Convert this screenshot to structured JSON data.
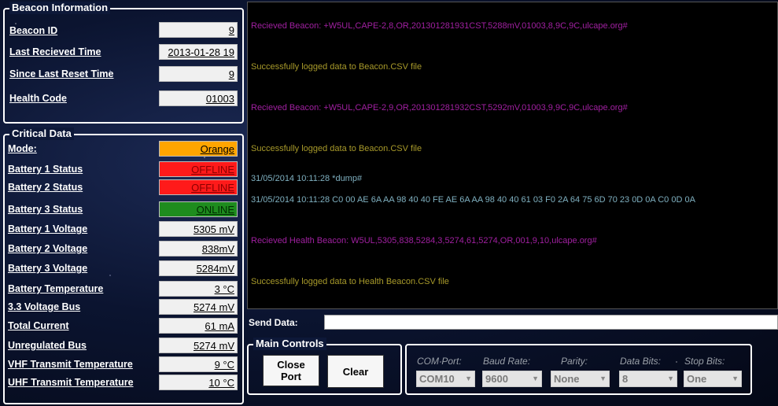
{
  "beacon_info": {
    "title": "Beacon Information",
    "fields": [
      {
        "label": "Beacon ID",
        "value": "9"
      },
      {
        "label": "Last Recieved Time",
        "value": "2013-01-28 19"
      },
      {
        "label": "Since Last Reset Time",
        "value": "9"
      },
      {
        "label": "Health Code",
        "value": "01003"
      }
    ]
  },
  "critical_data": {
    "title": "Critical Data",
    "mode": {
      "label": "Mode:",
      "value": "Orange",
      "color": "#ffa500"
    },
    "battery_status": [
      {
        "label": "Battery 1 Status",
        "value": "OFFLINE",
        "color": "#ff1a1a"
      },
      {
        "label": "Battery 2 Status",
        "value": "OFFLINE",
        "color": "#ff1a1a"
      },
      {
        "label": "Battery 3 Status",
        "value": "ONLINE",
        "color": "#1e8c1e"
      }
    ],
    "fields": [
      {
        "label": "Battery 1 Voltage",
        "value": "5305 mV"
      },
      {
        "label": "Battery 2 Voltage",
        "value": "838mV"
      },
      {
        "label": "Battery 3 Voltage",
        "value": "5284mV"
      },
      {
        "label": "Battery Temperature",
        "value": "3 °C"
      },
      {
        "label": "3.3 Voltage Bus",
        "value": "5274 mV"
      },
      {
        "label": "Total Current",
        "value": "61 mA"
      },
      {
        "label": "Unregulated Bus",
        "value": "5274 mV"
      },
      {
        "label": "VHF Transmit Temperature",
        "value": "9 °C"
      },
      {
        "label": "UHF Transmit Temperature",
        "value": "10 °C"
      }
    ]
  },
  "console": {
    "colors": {
      "beacon": "#a020a0",
      "logged": "#a89a2a",
      "dump": "#7fb0c0"
    },
    "lines": [
      {
        "text": "Recieved Beacon: +W5UL,CAPE-2,8,OR,201301281931CST,5288mV,01003,8,9C,9C,ulcape.org#",
        "kind": "beacon"
      },
      {
        "text": "Successfully logged data to Beacon.CSV file",
        "kind": "logged"
      },
      {
        "text": "Recieved Beacon: +W5UL,CAPE-2,9,OR,201301281932CST,5292mV,01003,9,9C,9C,ulcape.org#",
        "kind": "beacon"
      },
      {
        "text": "Successfully logged data to Beacon.CSV file",
        "kind": "logged"
      },
      {
        "text": "31/05/2014 10:11:28 *dump#",
        "kind": "dump"
      },
      {
        "text": "31/05/2014 10:11:28 C0 00 AE 6A AA 98 40 40 FE AE 6A AA 98 40 40 61 03 F0 2A 64 75 6D 70 23 0D 0A C0 0D 0A",
        "kind": "dump"
      },
      {
        "text": "Recieved Health Beacon: W5UL,5305,838,5284,3,5274,61,5274,OR,001,9,10,ulcape.org#",
        "kind": "beacon"
      },
      {
        "text": "Successfully logged data to Health Beacon.CSV file",
        "kind": "logged"
      }
    ]
  },
  "send": {
    "label": "Send Data:",
    "value": ""
  },
  "main_controls": {
    "title": "Main Controls",
    "close_port": "Close Port",
    "clear": "Clear"
  },
  "port_settings": {
    "com_port": {
      "label": "COM Port:",
      "value": "COM10"
    },
    "baud_rate": {
      "label": "Baud Rate:",
      "value": "9600"
    },
    "parity": {
      "label": "Parity:",
      "value": "None"
    },
    "data_bits": {
      "label": "Data Bits:",
      "value": "8"
    },
    "stop_bits": {
      "label": "Stop Bits:",
      "value": "One"
    }
  }
}
